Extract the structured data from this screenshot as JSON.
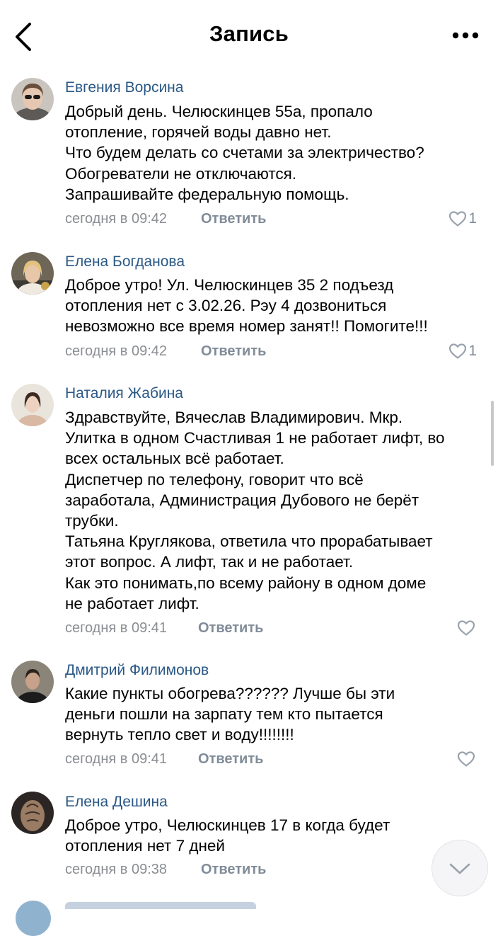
{
  "header": {
    "title": "Запись"
  },
  "comments": [
    {
      "author": "Евгения Ворсина",
      "lines": [
        "Добрый день. Челюскинцев 55а, пропало",
        "отопление, горячей воды давно нет.",
        "Что будем делать со счетами за электричество?",
        "Обогреватели не отключаются.",
        "Запрашивайте федеральную помощь."
      ],
      "time": "сегодня в 09:42",
      "reply": "Ответить",
      "likes": "1"
    },
    {
      "author": "Елена Богданова",
      "lines": [
        "Доброе утро! Ул. Челюскинцев 35 2 подъезд",
        "отопления нет с 3.02.26. Рэу 4 дозвониться",
        "невозможно все время номер занят!! Помогите!!!"
      ],
      "time": "сегодня в 09:42",
      "reply": "Ответить",
      "likes": "1"
    },
    {
      "author": "Наталия Жабина",
      "lines": [
        "Здравствуйте, Вячеслав Владимирович. Мкр.",
        "Улитка в одном Счастливая 1 не работает лифт, во",
        "всех остальных всё работает.",
        "Диспетчер по телефону, говорит что всё",
        "заработала, Администрация Дубового не берёт",
        "трубки.",
        "Татьяна Круглякова, ответила что прорабатывает",
        "этот вопрос. А лифт, так и не работает.",
        "Как это понимать,по всему району в одном доме",
        "не работает лифт."
      ],
      "time": "сегодня в 09:41",
      "reply": "Ответить",
      "likes": ""
    },
    {
      "author": "Дмитрий Филимонов",
      "lines": [
        "Какие пункты обогрева?????? Лучше бы эти",
        "деньги пошли на зарпату тем кто пытается",
        "вернуть тепло свет и воду!!!!!!!!"
      ],
      "time": "сегодня в 09:41",
      "reply": "Ответить",
      "likes": ""
    },
    {
      "author": "Елена Дешина",
      "lines": [
        "Доброе утро, Челюскинцев 17 в когда будет",
        "отопления нет 7 дней"
      ],
      "time": "сегодня в 09:38",
      "reply": "Ответить",
      "likes": ""
    }
  ],
  "colors": {
    "author": "#2a5885",
    "meta": "#8a8d92",
    "reply": "#818c99",
    "like_icon": "#99a2ad"
  },
  "icons": {
    "back": "chevron-left-icon",
    "more": "more-horizontal-icon",
    "like": "heart-outline-icon",
    "scroll": "chevron-down-icon"
  }
}
